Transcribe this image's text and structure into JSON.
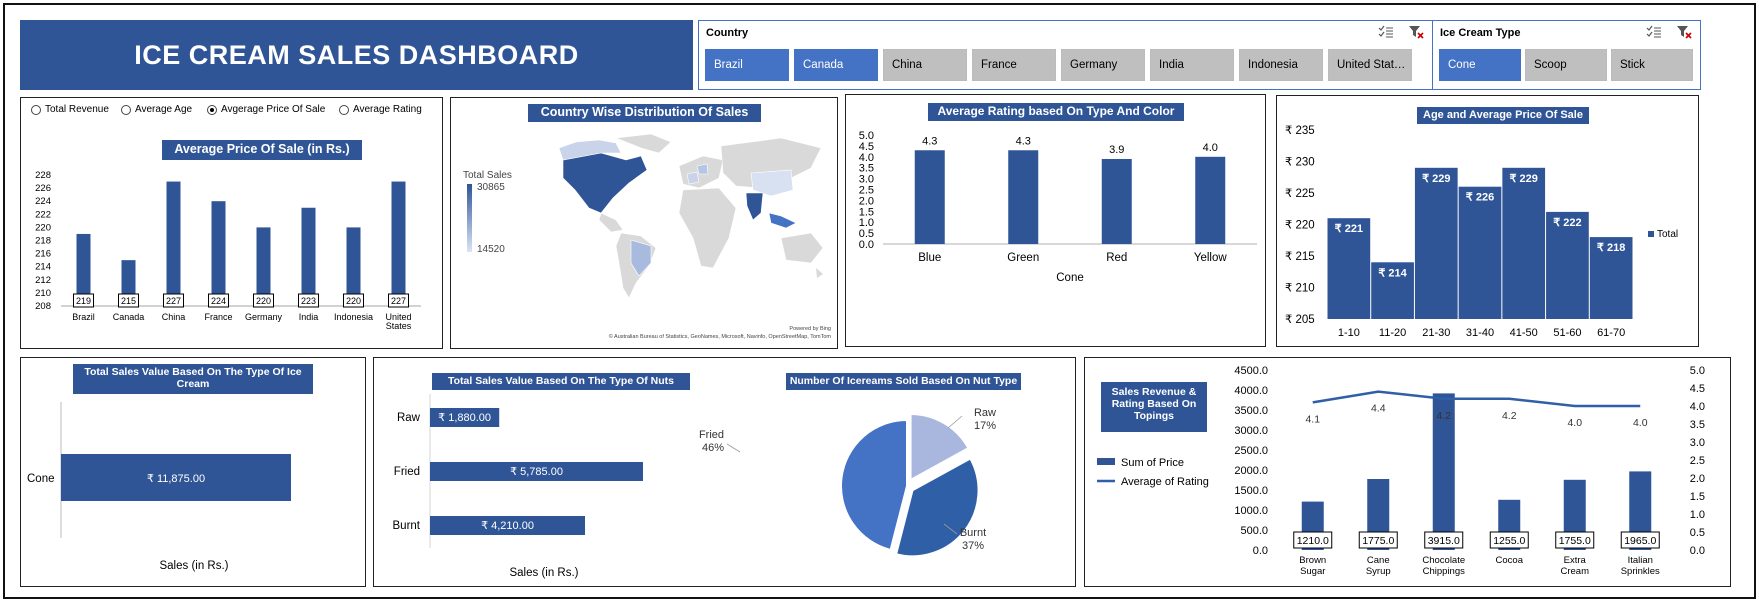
{
  "header": {
    "title": "ICE CREAM SALES DASHBOARD"
  },
  "colors": {
    "primary": "#2f5597",
    "accent": "#4472c4",
    "slicer_off": "#bfbfbf",
    "map_land": "#d9d9d9"
  },
  "country_slicer": {
    "title": "Country",
    "items": [
      {
        "label": "Brazil",
        "selected": true
      },
      {
        "label": "Canada",
        "selected": true
      },
      {
        "label": "China",
        "selected": false
      },
      {
        "label": "France",
        "selected": false
      },
      {
        "label": "Germany",
        "selected": false
      },
      {
        "label": "India",
        "selected": false
      },
      {
        "label": "Indonesia",
        "selected": false
      },
      {
        "label": "United Stat…",
        "selected": false
      }
    ],
    "icons": [
      "multi-select-icon",
      "clear-filter-icon"
    ]
  },
  "type_slicer": {
    "title": "Ice Cream Type",
    "items": [
      {
        "label": "Cone",
        "selected": true
      },
      {
        "label": "Scoop",
        "selected": false
      },
      {
        "label": "Stick",
        "selected": false
      }
    ],
    "icons": [
      "multi-select-icon",
      "clear-filter-icon"
    ]
  },
  "metric_selector": {
    "options": [
      "Total Revenue",
      "Average Age",
      "Avgerage Price Of Sale",
      "Average Rating"
    ],
    "selected_index": 2
  },
  "chart_data": [
    {
      "id": "avg-price",
      "type": "bar",
      "title": "Average Price Of Sale (in Rs.)",
      "categories": [
        "Brazil",
        "Canada",
        "China",
        "France",
        "Germany",
        "India",
        "Indonesia",
        "United States"
      ],
      "values": [
        219,
        215,
        227,
        224,
        220,
        223,
        220,
        227
      ],
      "labels": [
        "219",
        "215",
        "227",
        "224",
        "220",
        "223",
        "220",
        "227"
      ],
      "yticks": [
        "208",
        "210",
        "212",
        "214",
        "216",
        "218",
        "220",
        "222",
        "224",
        "226",
        "228"
      ],
      "ylim": [
        208,
        228
      ]
    },
    {
      "id": "map",
      "type": "heatmap",
      "title": "Country Wise Distribution Of Sales",
      "legend_title": "Total Sales",
      "legend_max": "30865",
      "legend_min": "14520",
      "credit_1": "Powered by Bing",
      "credit_2": "© Australian Bureau of Statistics, GeoNames, Microsoft, Navinfo, OpenStreetMap, TomTom"
    },
    {
      "id": "rating-color",
      "type": "bar",
      "title": "Average Rating based On Type And Color",
      "categories": [
        "Blue",
        "Green",
        "Red",
        "Yellow"
      ],
      "values": [
        4.3,
        4.3,
        3.9,
        4.0
      ],
      "labels": [
        "4.3",
        "4.3",
        "3.9",
        "4.0"
      ],
      "xlabel": "Cone",
      "yticks": [
        "0.0",
        "0.5",
        "1.0",
        "1.5",
        "2.0",
        "2.5",
        "3.0",
        "3.5",
        "4.0",
        "4.5",
        "5.0"
      ],
      "ylim": [
        0,
        5
      ]
    },
    {
      "id": "age-price",
      "type": "bar",
      "title": "Age and Average Price Of Sale",
      "categories": [
        "1-10",
        "11-20",
        "21-30",
        "31-40",
        "41-50",
        "51-60",
        "61-70"
      ],
      "values": [
        221,
        214,
        229,
        226,
        229,
        222,
        218
      ],
      "labels": [
        "₹ 221",
        "₹ 214",
        "₹ 229",
        "₹ 226",
        "₹ 229",
        "₹ 222",
        "₹ 218"
      ],
      "yticks": [
        "₹ 205",
        "₹ 210",
        "₹ 215",
        "₹ 220",
        "₹ 225",
        "₹ 230",
        "₹ 235"
      ],
      "ylim": [
        205,
        235
      ],
      "legend": "Total"
    },
    {
      "id": "type-sales",
      "type": "bar",
      "title": "Total Sales Value Based On The Type Of Ice Cream",
      "categories": [
        "Cone"
      ],
      "values": [
        11875
      ],
      "labels": [
        "₹ 11,875.00"
      ],
      "xlabel": "Sales (in Rs.)"
    },
    {
      "id": "nut-sales",
      "type": "bar",
      "title": "Total Sales Value Based On The Type Of Nuts",
      "categories": [
        "Raw",
        "Fried",
        "Burnt"
      ],
      "values": [
        1880,
        5785,
        4210
      ],
      "labels": [
        "₹ 1,880.00",
        "₹ 5,785.00",
        "₹ 4,210.00"
      ],
      "xlabel": "Sales (in Rs.)"
    },
    {
      "id": "nut-pie",
      "type": "pie",
      "title": "Number Of Icereams Sold Based On Nut Type",
      "categories": [
        "Fried",
        "Raw",
        "Burnt"
      ],
      "values": [
        46,
        17,
        37
      ],
      "labels": [
        "46%",
        "17%",
        "37%"
      ]
    },
    {
      "id": "toppings",
      "type": "bar",
      "title": "Sales Revenue & Rating Based On Topings",
      "categories": [
        "Brown Sugar",
        "Cane Syrup",
        "Chocolate Chippings",
        "Cocoa",
        "Extra Cream",
        "Italian Sprinkles"
      ],
      "series": [
        {
          "name": "Sum of Price",
          "values": [
            1210,
            1775,
            3915,
            1255,
            1755,
            1965
          ],
          "labels": [
            "1210.0",
            "1775.0",
            "3915.0",
            "1255.0",
            "1755.0",
            "1965.0"
          ]
        },
        {
          "name": "Average of Rating",
          "values": [
            4.1,
            4.4,
            4.2,
            4.2,
            4.0,
            4.0
          ],
          "labels": [
            "4.1",
            "4.4",
            "4.2",
            "4.2",
            "4.0",
            "4.0"
          ]
        }
      ],
      "yticks_left": [
        "0.0",
        "500.0",
        "1000.0",
        "1500.0",
        "2000.0",
        "2500.0",
        "3000.0",
        "3500.0",
        "4000.0",
        "4500.0"
      ],
      "yticks_right": [
        "0.0",
        "0.5",
        "1.0",
        "1.5",
        "2.0",
        "2.5",
        "3.0",
        "3.5",
        "4.0",
        "4.5",
        "5.0"
      ],
      "ylim_left": [
        0,
        4500
      ],
      "ylim_right": [
        0,
        5
      ]
    }
  ]
}
